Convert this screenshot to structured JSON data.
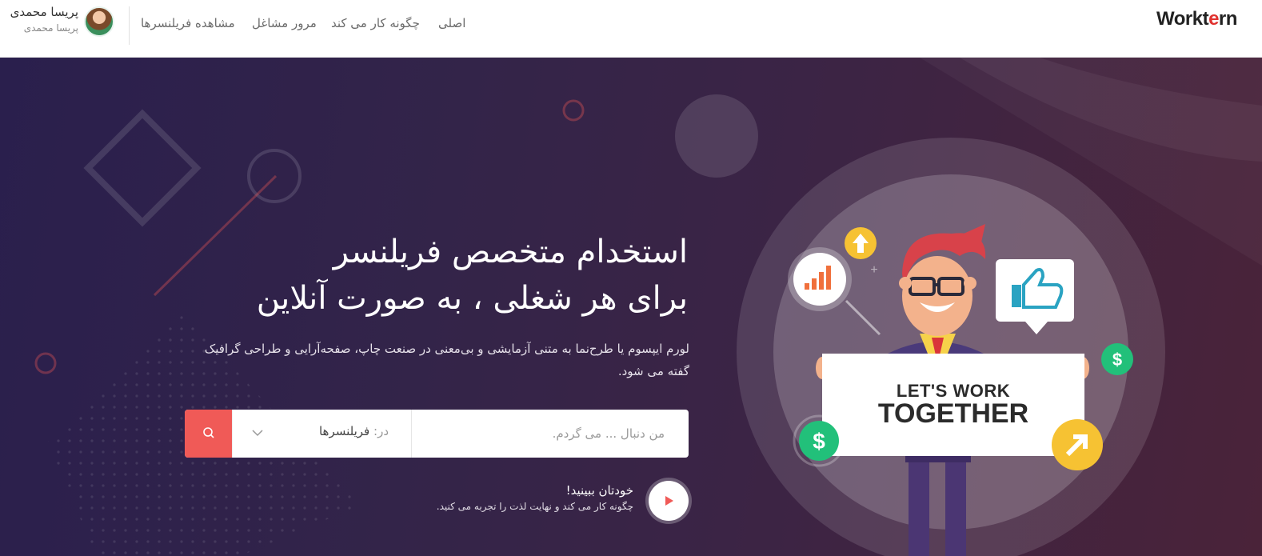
{
  "header": {
    "logo_main": "Workt",
    "logo_accent": "e",
    "logo_tail": "rn",
    "nav": {
      "home": "اصلی",
      "how_it_works": "چگونه کار می کند",
      "browse_jobs": "مرور مشاغل",
      "view_freelancers": "مشاهده فریلنسرها"
    },
    "user": {
      "name": "پریسا محمدی",
      "subtitle": "پریسا محمدی"
    }
  },
  "hero": {
    "headline_line1": "استخدام متخصص فریلنسر",
    "headline_line2": "برای هر شغلی ، به صورت آنلاین",
    "subtext": "لورم ایپسوم یا طرح‌نما به متنی آزمایشی و بی‌معنی در صنعت چاپ، صفحه‌آرایی و طراحی گرافیک گفته می شود.",
    "search": {
      "placeholder": "من دنبال ... می گردم.",
      "category_prefix": "در:",
      "category_value": "فریلنسرها"
    },
    "video": {
      "title": "خودتان ببینید!",
      "subtitle": "چگونه کار می کند و نهایت لذت را تجربه می کنید."
    },
    "sign": {
      "line1": "LET'S WORK",
      "line2": "TOGETHER"
    }
  },
  "colors": {
    "accent": "#f05a57",
    "hero_bg_start": "#2a1f4d",
    "hero_bg_end": "#4a2339"
  },
  "icons": {
    "search": "search-icon",
    "play": "play-icon",
    "chevron": "chevron-down-icon"
  }
}
